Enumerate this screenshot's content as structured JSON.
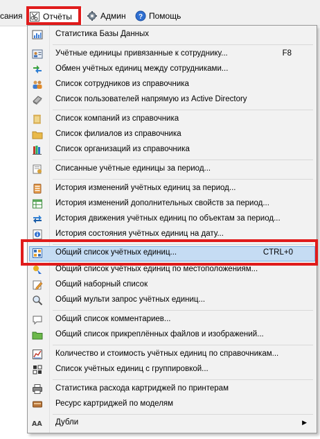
{
  "menubar": {
    "partial_item": "сания",
    "reports": "Отчёты",
    "admin": "Админ",
    "help": "Помощь"
  },
  "menu": {
    "items": [
      {
        "label": "Статистика Базы Данных",
        "icon": "database-stats-icon"
      },
      {
        "label": "Учётные единицы привязанные к сотруднику...",
        "shortcut": "F8",
        "icon": "user-card-icon"
      },
      {
        "label": "Обмен учётных единиц между сотрудниками...",
        "icon": "exchange-arrows-icon"
      },
      {
        "label": "Список сотрудников из справочника",
        "icon": "employees-icon"
      },
      {
        "label": "Список пользователей напрямую из Active Directory",
        "icon": "active-directory-book-icon"
      },
      {
        "label": "Список компаний из справочника",
        "icon": "scroll-icon"
      },
      {
        "label": "Список филиалов из справочника",
        "icon": "branch-folder-icon"
      },
      {
        "label": "Список организаций из справочника",
        "icon": "books-icon"
      },
      {
        "label": "Списанные учётные единицы за период...",
        "icon": "write-off-icon"
      },
      {
        "label": "История изменений учётных единиц за период...",
        "icon": "history-icon"
      },
      {
        "label": "История изменений дополнительных свойств за период...",
        "icon": "properties-grid-icon"
      },
      {
        "label": "История движения учётных единиц по объектам за период...",
        "icon": "movement-arrows-icon"
      },
      {
        "label": "История состояния учётных единиц на дату...",
        "icon": "status-info-icon"
      },
      {
        "label": "Общий список учётных единиц...",
        "shortcut": "CTRL+0",
        "icon": "list-grid-icon"
      },
      {
        "label": "Общий список учётных единиц по местоположениям...",
        "icon": "location-icon"
      },
      {
        "label": "Общий наборный список",
        "icon": "pencil-note-icon"
      },
      {
        "label": "Общий мульти запрос учётных единиц...",
        "icon": "magnifier-icon"
      },
      {
        "label": "Общий список комментариев...",
        "icon": "comment-icon"
      },
      {
        "label": "Общий список прикреплённых файлов и изображений...",
        "icon": "attachment-folder-icon"
      },
      {
        "label": "Количество и стоимость учётных единиц по справочникам...",
        "icon": "cost-chart-icon"
      },
      {
        "label": "Список учётных единиц с группировкой...",
        "icon": "grouping-icon"
      },
      {
        "label": "Статистика расхода картриджей по принтерам",
        "icon": "printer-icon"
      },
      {
        "label": "Ресурс картриджей по моделям",
        "icon": "cartridge-icon"
      },
      {
        "label": "Дубли",
        "icon": "duplicates-aa-icon",
        "submenu": true
      }
    ]
  },
  "colors": {
    "highlight_red": "#e01b1b",
    "selected_bg": "#c5dcf3",
    "selected_border": "#7eb2e6",
    "menu_bg": "#f2f2f2"
  }
}
